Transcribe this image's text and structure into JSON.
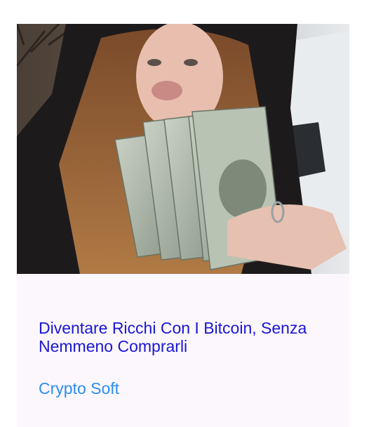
{
  "ad": {
    "image_alt": "Woman holding US dollar banknotes",
    "headline": "Diventare Ricchi Con I Bitcoin, Senza Nemmeno Comprarli",
    "source": "Crypto Soft"
  },
  "colors": {
    "card_background": "#fcf7fd",
    "headline": "#1a16d4",
    "source": "#2b8ef0"
  }
}
